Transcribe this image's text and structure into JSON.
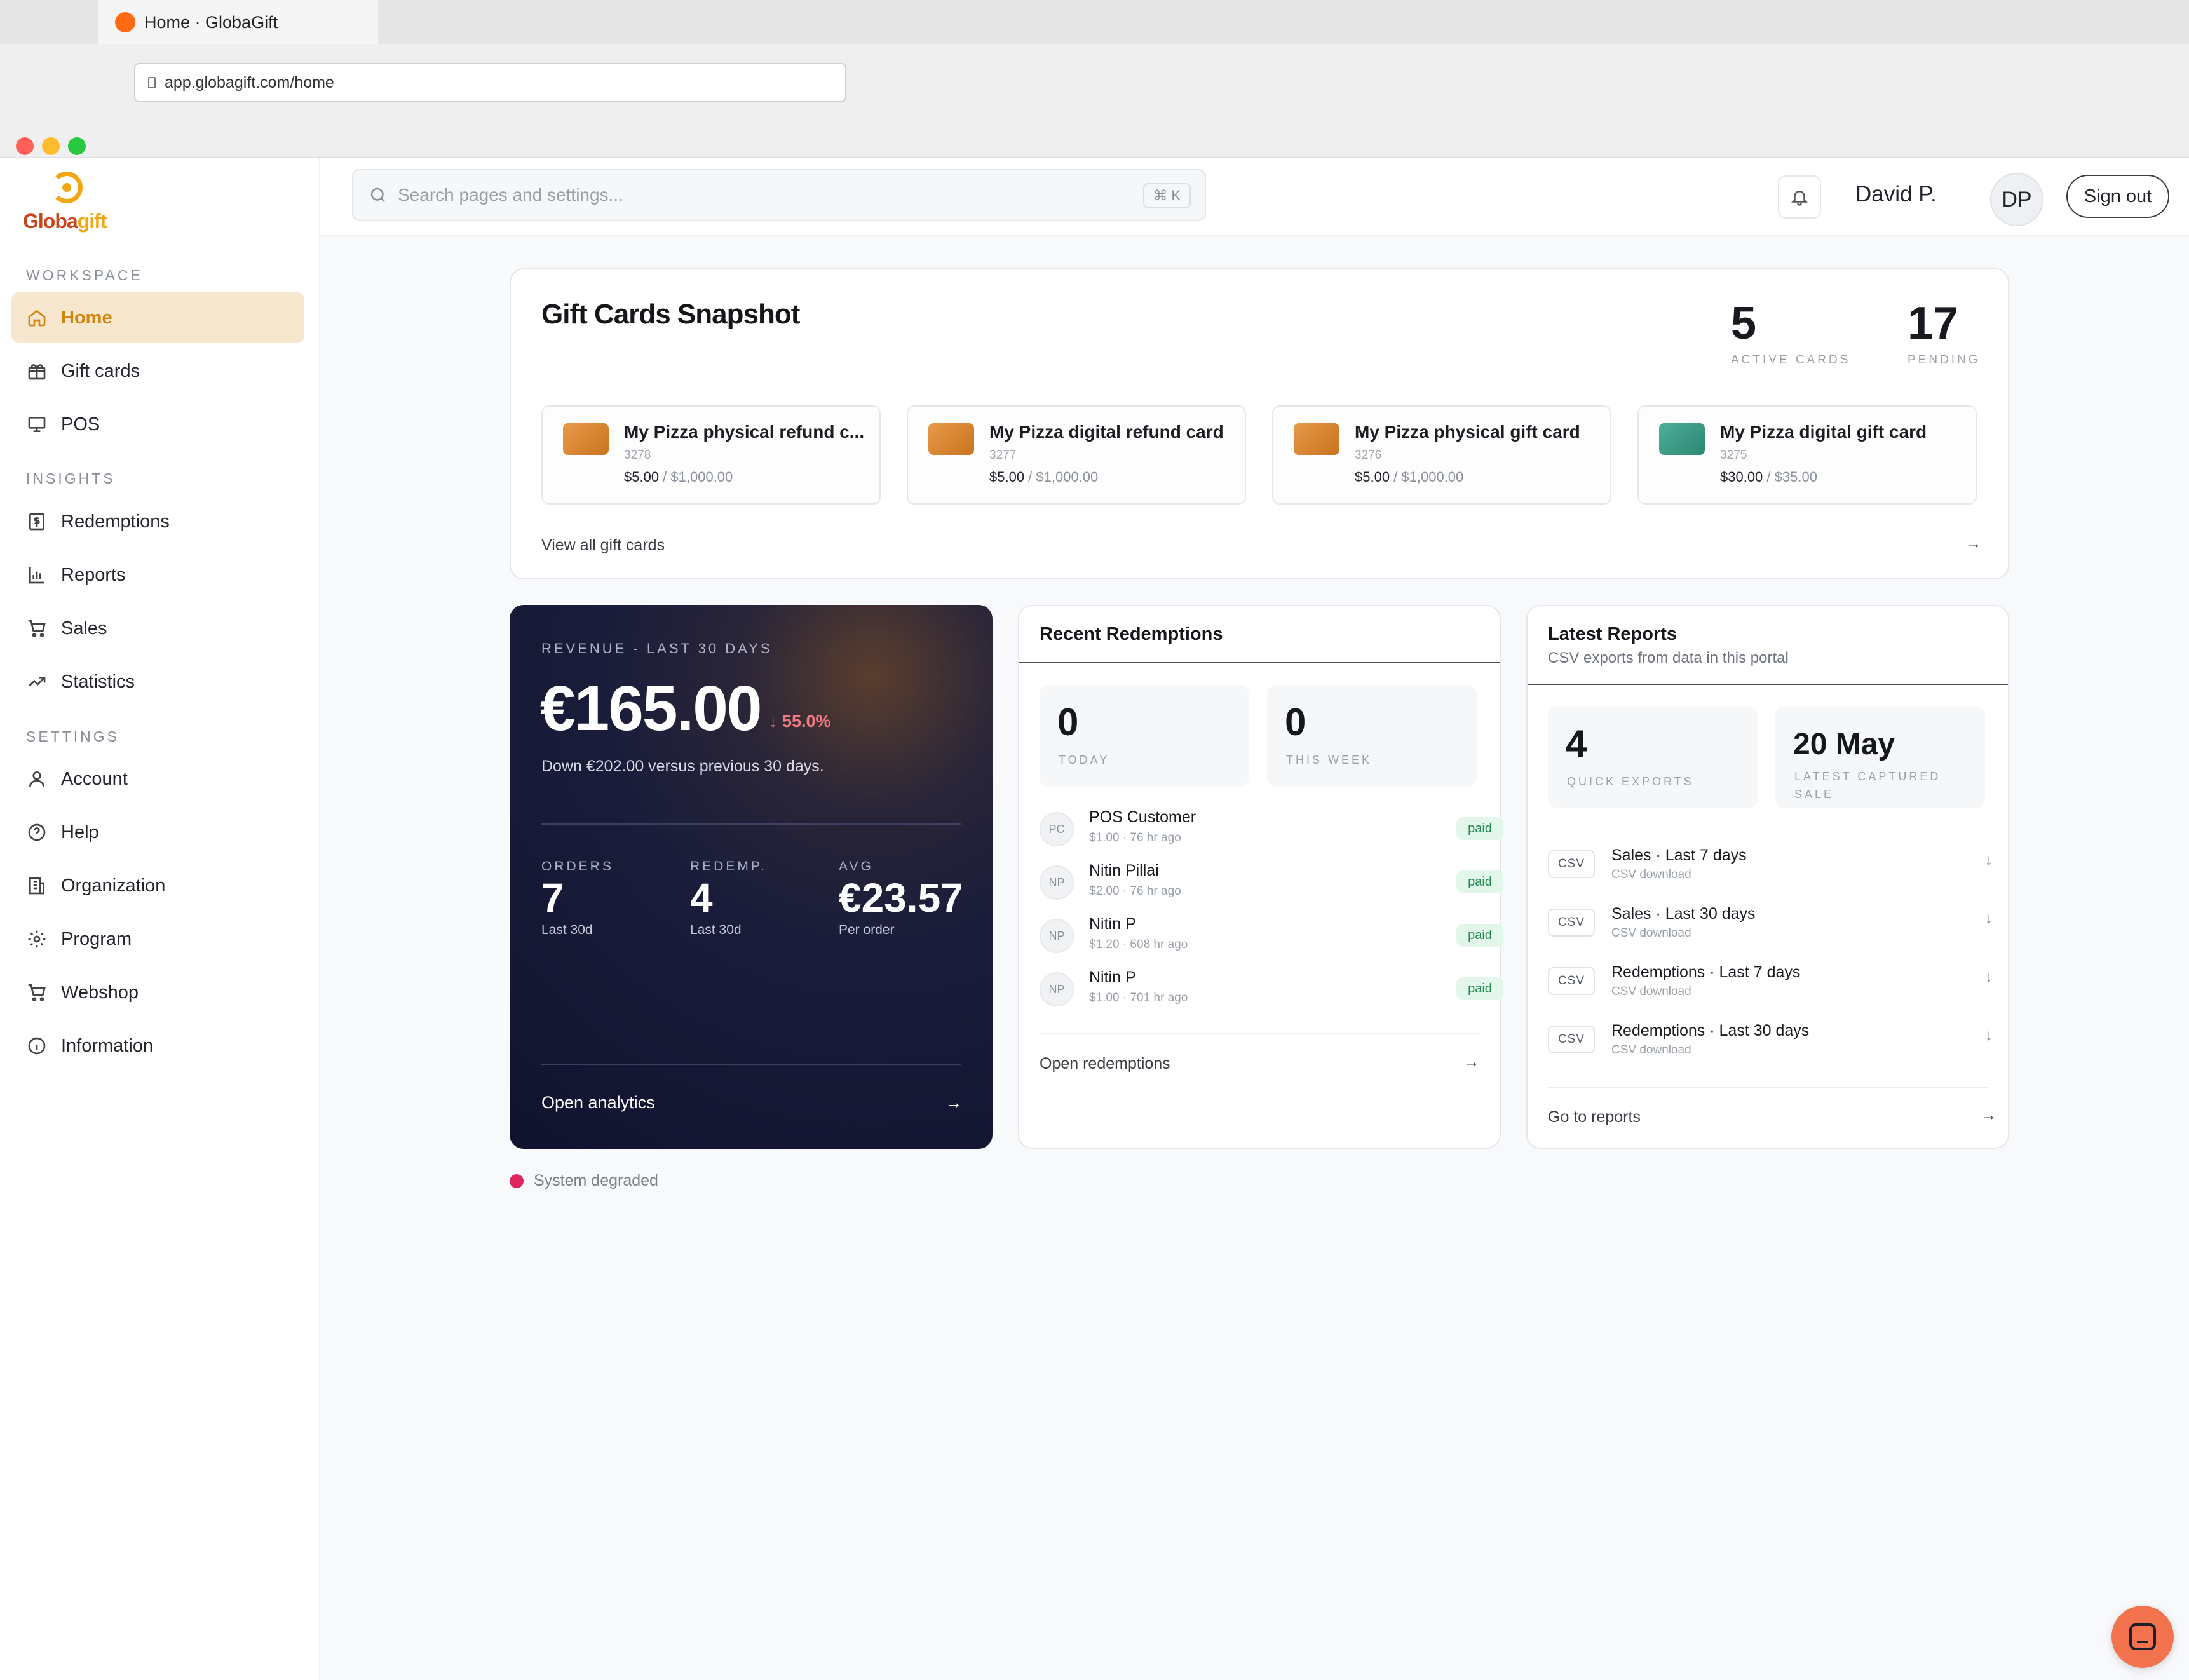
{
  "browser": {
    "tab_title": "Home · GlobaGift",
    "url": "app.globagift.com/home",
    "traffic_light_colors": [
      "#ff5f57",
      "#febc2e",
      "#28c840"
    ]
  },
  "brand": {
    "logo_part1": "Globa",
    "logo_part2": "gift",
    "accent": "#f3a614",
    "accent_dark": "#c7461c"
  },
  "sidebar": {
    "workspace_label": "WORKSPACE",
    "insights_label": "INSIGHTS",
    "settings_label": "SETTINGS",
    "items": [
      {
        "label": "Home",
        "icon": "home-icon"
      },
      {
        "label": "Gift cards",
        "icon": "gift-icon"
      },
      {
        "label": "POS",
        "icon": "monitor-icon"
      },
      {
        "label": "Redemptions",
        "icon": "dollar-receipt-icon"
      },
      {
        "label": "Reports",
        "icon": "bar-chart-icon"
      },
      {
        "label": "Sales",
        "icon": "cart-icon"
      },
      {
        "label": "Statistics",
        "icon": "trending-up-icon"
      },
      {
        "label": "Account",
        "icon": "user-icon"
      },
      {
        "label": "Help",
        "icon": "help-circle-icon"
      },
      {
        "label": "Organization",
        "icon": "building-icon"
      },
      {
        "label": "Program",
        "icon": "gear-icon"
      },
      {
        "label": "Webshop",
        "icon": "cart-icon"
      },
      {
        "label": "Information",
        "icon": "info-icon"
      }
    ]
  },
  "header": {
    "search_placeholder": "Search pages and settings...",
    "search_shortcut": "⌘ K",
    "user_name": "David P.",
    "avatar_initials": "DP",
    "signout_label": "Sign out"
  },
  "snapshot": {
    "title": "Gift Cards Snapshot",
    "active_value": "5",
    "active_label": "ACTIVE CARDS",
    "pending_value": "17",
    "pending_label": "PENDING",
    "cards": [
      {
        "name": "My Pizza physical refund c...",
        "id": "3278",
        "balance": "$5.00",
        "max": " / $1,000.00",
        "color": "#e08a32"
      },
      {
        "name": "My Pizza digital refund card",
        "id": "3277",
        "balance": "$5.00",
        "max": " / $1,000.00",
        "color": "#e08a32"
      },
      {
        "name": "My Pizza physical gift card",
        "id": "3276",
        "balance": "$5.00",
        "max": " / $1,000.00",
        "color": "#e08a32"
      },
      {
        "name": "My Pizza digital gift card",
        "id": "3275",
        "balance": "$30.00",
        "max": " / $35.00",
        "color": "#3a9a86"
      }
    ],
    "view_all": "View all gift cards"
  },
  "revenue": {
    "caption": "REVENUE - LAST 30 DAYS",
    "amount": "€165.00",
    "change": "↓ 55.0%",
    "subtitle": "Down €202.00 versus previous 30 days.",
    "metrics": [
      {
        "label": "ORDERS",
        "value": "7",
        "sub": "Last 30d"
      },
      {
        "label": "REDEMP.",
        "value": "4",
        "sub": "Last 30d"
      },
      {
        "label": "AVG",
        "value": "€23.57",
        "sub": "Per order"
      }
    ],
    "open_analytics": "Open analytics"
  },
  "redemptions": {
    "title": "Recent Redemptions",
    "today_value": "0",
    "today_label": "TODAY",
    "week_value": "0",
    "week_label": "THIS WEEK",
    "rows": [
      {
        "initials": "PC",
        "name": "POS Customer",
        "detail": "$1.00 · 76 hr ago",
        "status": "paid"
      },
      {
        "initials": "NP",
        "name": "Nitin Pillai",
        "detail": "$2.00 · 76 hr ago",
        "status": "paid"
      },
      {
        "initials": "NP",
        "name": "Nitin P",
        "detail": "$1.20 · 608 hr ago",
        "status": "paid"
      },
      {
        "initials": "NP",
        "name": "Nitin P",
        "detail": "$1.00 · 701 hr ago",
        "status": "paid"
      }
    ],
    "open_link": "Open redemptions"
  },
  "reports": {
    "title": "Latest Reports",
    "subtitle": "CSV exports from data in this portal",
    "quick_value": "4",
    "quick_label": "QUICK EXPORTS",
    "latest_value": "20 May",
    "latest_label": "LATEST CAPTURED SALE",
    "rows": [
      {
        "tag": "CSV",
        "name": "Sales · Last 7 days",
        "detail": "CSV download"
      },
      {
        "tag": "CSV",
        "name": "Sales · Last 30 days",
        "detail": "CSV download"
      },
      {
        "tag": "CSV",
        "name": "Redemptions · Last 7 days",
        "detail": "CSV download"
      },
      {
        "tag": "CSV",
        "name": "Redemptions · Last 30 days",
        "detail": "CSV download"
      }
    ],
    "go_link": "Go to reports"
  },
  "status": {
    "text": "System degraded",
    "color": "#e0245e"
  }
}
